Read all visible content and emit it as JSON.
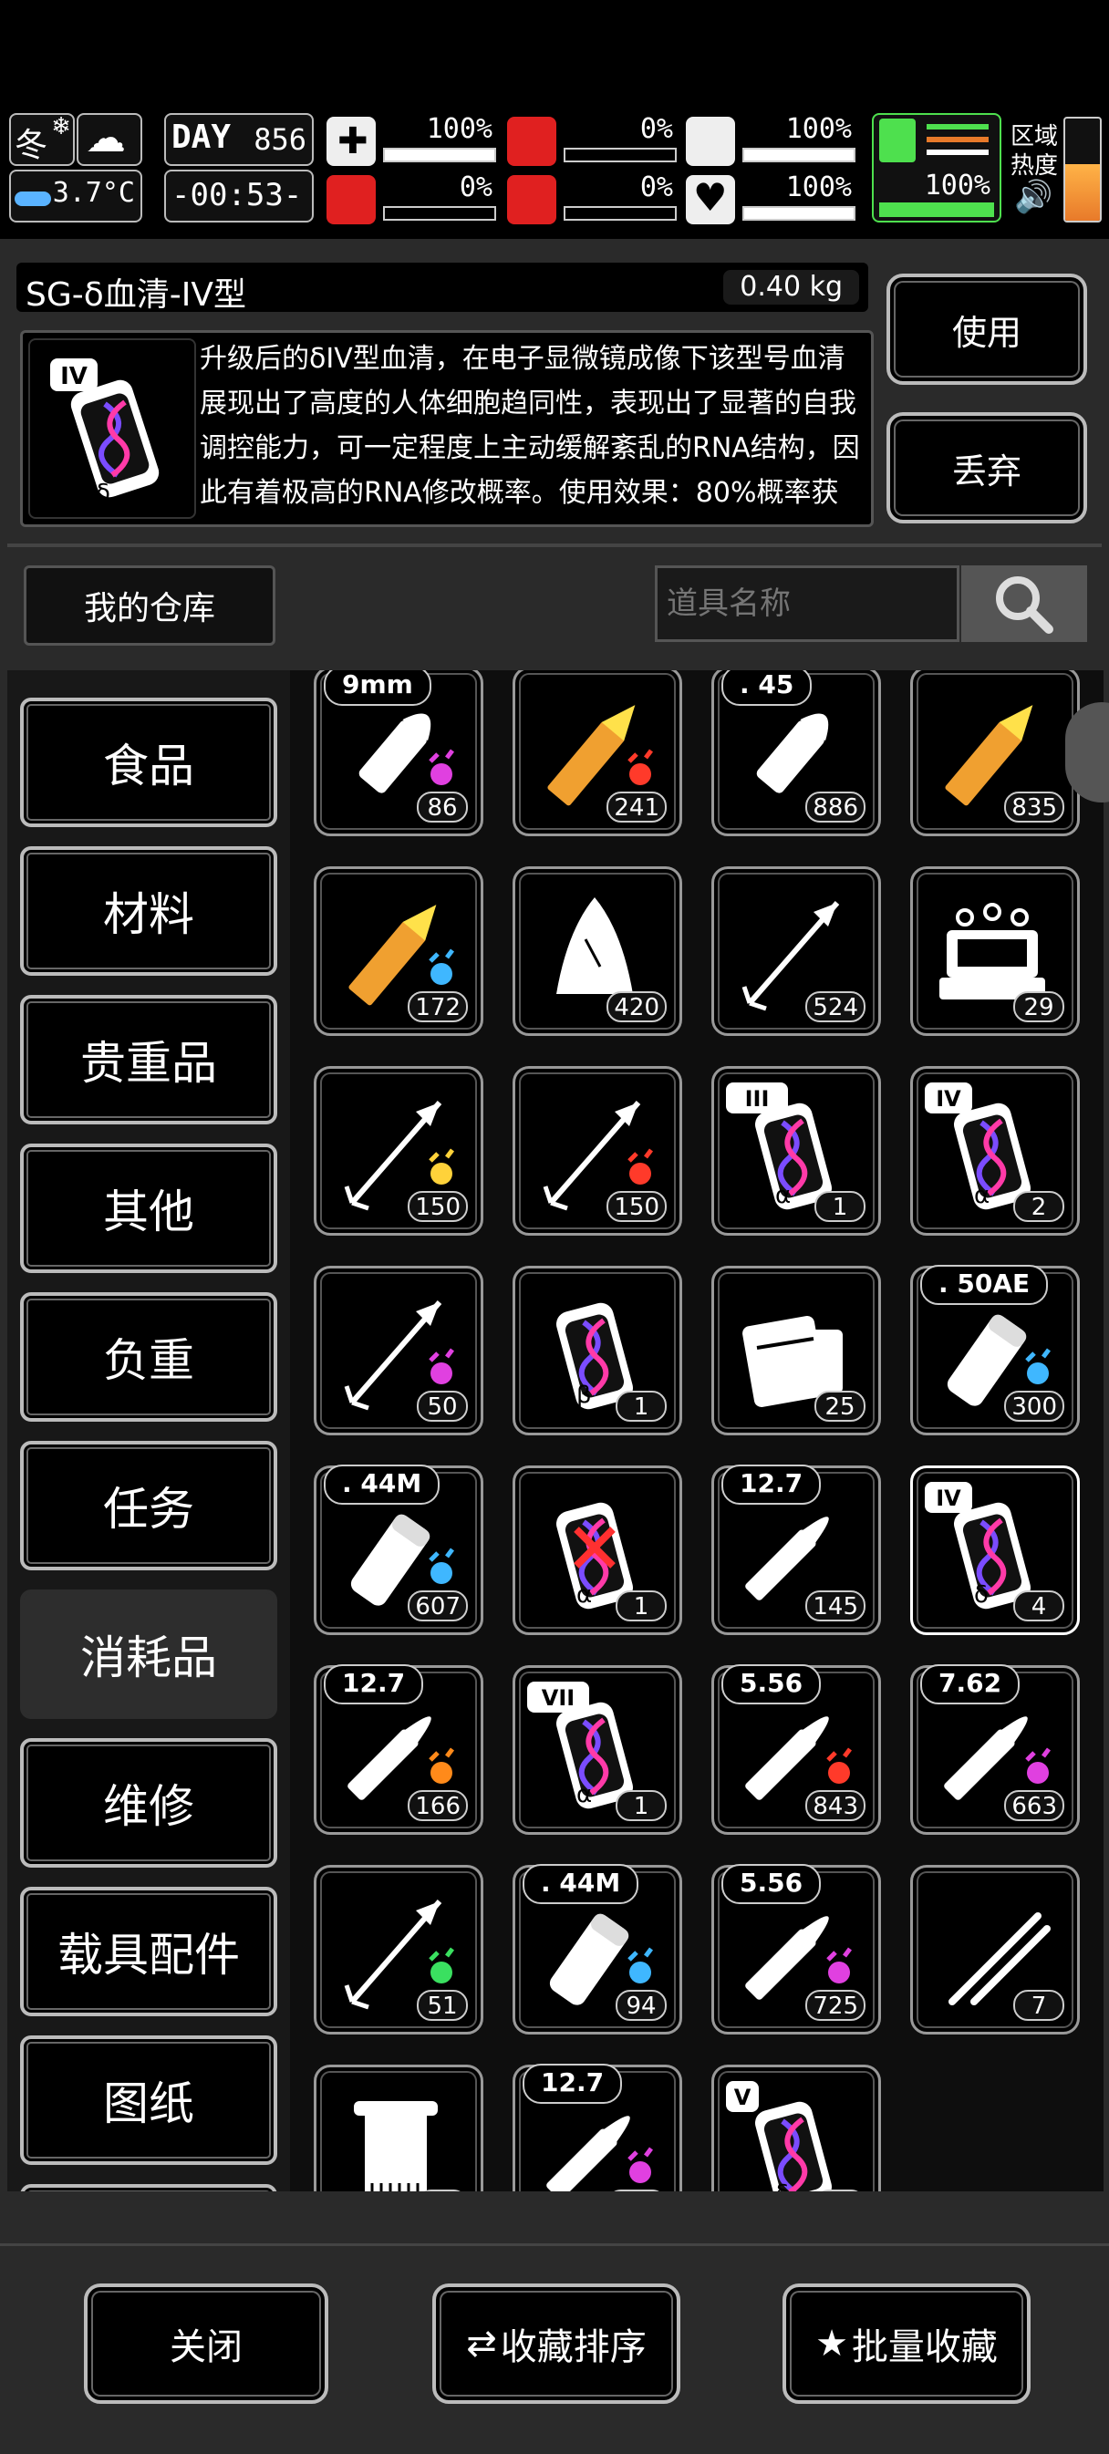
{
  "status": {
    "season": "冬",
    "temperature": "3.7°C",
    "day_label": "DAY",
    "day_number": "856",
    "clock": "-00:53-",
    "stats": [
      {
        "name": "health",
        "value": "100%",
        "fill": 1.0
      },
      {
        "name": "hunger",
        "value": "0%",
        "fill": 0.0
      },
      {
        "name": "water",
        "value": "100%",
        "fill": 1.0
      },
      {
        "name": "brain",
        "value": "0%",
        "fill": 0.0
      },
      {
        "name": "blood",
        "value": "0%",
        "fill": 0.0
      },
      {
        "name": "mood",
        "value": "100%",
        "fill": 1.0
      },
      {
        "name": "stamina",
        "value": "100%",
        "fill": 1.0
      }
    ],
    "zone_heat_label": "区域\n热度",
    "colors": {
      "stamina": "#4ee04e",
      "blood": "#e02020",
      "ice": "#5ab3ff"
    }
  },
  "item": {
    "name": "SG-δ血清-IV型",
    "weight": "0.40 kg",
    "description": "升级后的δIV型血清，在电子显微镜成像下该型号血清展现出了高度的人体细胞趋同性，表现出了显著的自我调控能力，可一定程度上主动缓解紊乱的RNA结构，因此有着极高的RNA修改概率。使用效果：80%概率获得SG生命体·4阶buff、",
    "use_label": "使用",
    "drop_label": "丢弃"
  },
  "warehouse": {
    "title": "我的仓库",
    "search_placeholder": "道具名称"
  },
  "categories": [
    {
      "label": "食品",
      "active": false
    },
    {
      "label": "材料",
      "active": false
    },
    {
      "label": "贵重品",
      "active": false
    },
    {
      "label": "其他",
      "active": false
    },
    {
      "label": "负重",
      "active": false
    },
    {
      "label": "任务",
      "active": false
    },
    {
      "label": "消耗品",
      "active": true
    },
    {
      "label": "维修",
      "active": false
    },
    {
      "label": "载具配件",
      "active": false
    },
    {
      "label": "图纸",
      "active": false
    },
    {
      "label": "蓝图",
      "active": false
    }
  ],
  "slots": [
    {
      "icon": "bullet-icon",
      "caliber": "9mm",
      "count": "86",
      "effect": "pink"
    },
    {
      "icon": "rocket-icon",
      "caliber": "",
      "count": "241",
      "effect": "fire"
    },
    {
      "icon": "bullet-icon",
      "caliber": ". 45",
      "count": "886",
      "effect": ""
    },
    {
      "icon": "rocket-icon",
      "caliber": "",
      "count": "835",
      "effect": ""
    },
    {
      "icon": "rocket-icon",
      "caliber": "",
      "count": "172",
      "effect": "water"
    },
    {
      "icon": "cloth-icon",
      "caliber": "",
      "count": "420",
      "effect": ""
    },
    {
      "icon": "arrow-icon",
      "caliber": "",
      "count": "524",
      "effect": ""
    },
    {
      "icon": "machine-icon",
      "caliber": "",
      "count": "29",
      "effect": ""
    },
    {
      "icon": "arrow-icon",
      "caliber": "",
      "count": "150",
      "effect": "electric"
    },
    {
      "icon": "arrow-icon",
      "caliber": "",
      "count": "150",
      "effect": "fire"
    },
    {
      "icon": "serum-icon",
      "caliber": "",
      "count": "1",
      "effect": "",
      "tier": "III",
      "greek": "α"
    },
    {
      "icon": "serum-icon",
      "caliber": "",
      "count": "2",
      "effect": "",
      "tier": "IV",
      "greek": "α"
    },
    {
      "icon": "arrow-icon",
      "caliber": "",
      "count": "50",
      "effect": "pink"
    },
    {
      "icon": "serum-icon",
      "caliber": "",
      "count": "1",
      "effect": "",
      "tier": "",
      "greek": "β"
    },
    {
      "icon": "supply-icon",
      "caliber": "",
      "count": "25",
      "effect": ""
    },
    {
      "icon": "shell-icon",
      "caliber": ". 50AE",
      "count": "300",
      "effect": "blue"
    },
    {
      "icon": "shell-icon",
      "caliber": ". 44M",
      "count": "607",
      "effect": "blue"
    },
    {
      "icon": "serum-icon",
      "caliber": "",
      "count": "1",
      "effect": "",
      "tier": "",
      "greek": "α",
      "broken": true
    },
    {
      "icon": "rifle-round-icon",
      "caliber": "12.7",
      "count": "145",
      "effect": ""
    },
    {
      "icon": "serum-icon",
      "caliber": "",
      "count": "4",
      "effect": "",
      "tier": "IV",
      "greek": "δ",
      "selected": true
    },
    {
      "icon": "rifle-round-icon",
      "caliber": "12.7",
      "count": "166",
      "effect": "burst"
    },
    {
      "icon": "serum-icon",
      "caliber": "",
      "count": "1",
      "effect": "",
      "tier": "VII",
      "greek": "α"
    },
    {
      "icon": "rifle-round-icon",
      "caliber": "5.56",
      "count": "843",
      "effect": "fire"
    },
    {
      "icon": "rifle-round-icon",
      "caliber": "7.62",
      "count": "663",
      "effect": "pink"
    },
    {
      "icon": "arrow-icon",
      "caliber": "",
      "count": "51",
      "effect": "poison"
    },
    {
      "icon": "shell-icon",
      "caliber": ". 44M",
      "count": "94",
      "effect": "water"
    },
    {
      "icon": "rifle-round-icon",
      "caliber": "5.56",
      "count": "725",
      "effect": "pink"
    },
    {
      "icon": "tweezers-icon",
      "caliber": "",
      "count": "7",
      "effect": ""
    },
    {
      "icon": "towel-icon",
      "caliber": "",
      "count": "41",
      "effect": ""
    },
    {
      "icon": "rifle-round-icon",
      "caliber": "12.7",
      "count": "752",
      "effect": "pink"
    },
    {
      "icon": "serum-icon",
      "caliber": "",
      "count": "1",
      "effect": "",
      "tier": "V",
      "greek": "δ"
    }
  ],
  "footer": {
    "close_label": "关闭",
    "sort_label": "收藏排序",
    "batch_label": "批量收藏"
  }
}
